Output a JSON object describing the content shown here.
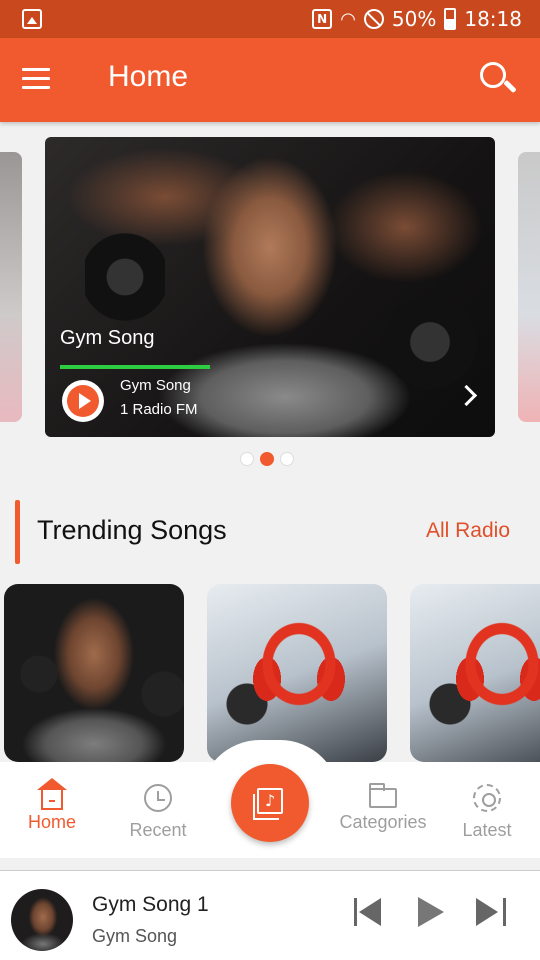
{
  "status_bar": {
    "battery": "50%",
    "time": "18:18",
    "icons": [
      "gallery-icon",
      "nfc-icon",
      "wifi-icon",
      "do-not-disturb-icon",
      "battery-charging-icon"
    ]
  },
  "app_bar": {
    "title": "Home",
    "menu_icon": "hamburger-menu-icon",
    "search_icon": "search-icon",
    "color": "#f05a2e"
  },
  "banner": {
    "title": "Gym Song",
    "subtitle_1": "Gym Song",
    "subtitle_2": "1 Radio FM",
    "progress": 1.0,
    "progress_color": "#2ecc40",
    "page_count": 3,
    "active_page": 2
  },
  "trending": {
    "title": "Trending Songs",
    "link": "All Radio",
    "cards": [
      "gym-card",
      "headphones-card",
      "headphones-card"
    ]
  },
  "bottom_nav": {
    "items": [
      {
        "label": "Home",
        "icon": "home-icon",
        "active": true
      },
      {
        "label": "Recent",
        "icon": "history-icon",
        "active": false
      },
      {
        "label": "Categories",
        "icon": "folder-icon",
        "active": false
      },
      {
        "label": "Latest",
        "icon": "gear-icon",
        "active": false
      }
    ],
    "center_icon": "music-library-icon"
  },
  "player": {
    "title": "Gym Song 1",
    "subtitle": "Gym Song",
    "controls": [
      "skip-previous-icon",
      "play-icon",
      "skip-next-icon"
    ]
  }
}
